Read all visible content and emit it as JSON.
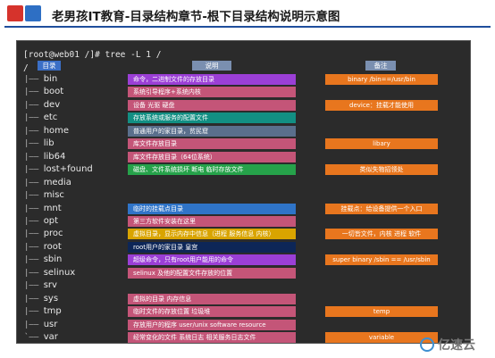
{
  "title": "老男孩IT教育-目录结构章节-根下目录结构说明示意图",
  "command": "[root@web01 /]# tree -L 1 /",
  "root_slash": "/",
  "headers": {
    "dir": "目录",
    "desc": "说明",
    "note": "备注"
  },
  "colors": {
    "orange": "#e8761e",
    "purple": "#9b3fd6",
    "pink": "#c45578",
    "teal": "#128f83",
    "slate": "#5a6f8c",
    "green": "#26a24a",
    "blue": "#2f74c8",
    "gold": "#d9a400",
    "navy": "#0d2657"
  },
  "rows": [
    {
      "tree": "|—— ",
      "name": "bin",
      "desc": "命令，二进制文件的存放目录",
      "desc_color": "purple",
      "note": "binary /bin==/usr/bin"
    },
    {
      "tree": "|—— ",
      "name": "boot",
      "desc": "系统引导程序+系统内核",
      "desc_color": "pink",
      "note": ""
    },
    {
      "tree": "|—— ",
      "name": "dev",
      "desc": "设备 光驱 硬盘",
      "desc_color": "pink",
      "note": "device：挂载才能使用"
    },
    {
      "tree": "|—— ",
      "name": "etc",
      "desc": "存放系统或服务的配置文件",
      "desc_color": "teal",
      "note": ""
    },
    {
      "tree": "|—— ",
      "name": "home",
      "desc": "普通用户的家目录，贫民窟",
      "desc_color": "slate",
      "note": ""
    },
    {
      "tree": "|—— ",
      "name": "lib",
      "desc": "库文件存放目录",
      "desc_color": "pink",
      "note": "libary"
    },
    {
      "tree": "|—— ",
      "name": "lib64",
      "desc": "库文件存放目录（64位系统）",
      "desc_color": "pink",
      "note": ""
    },
    {
      "tree": "|—— ",
      "name": "lost+found",
      "desc": "磁盘、文件系统损坏 断电 临时存放文件",
      "desc_color": "green",
      "note": "类似失物招领处"
    },
    {
      "tree": "|—— ",
      "name": "media",
      "desc": "",
      "desc_color": "",
      "note": ""
    },
    {
      "tree": "|—— ",
      "name": "misc",
      "desc": "",
      "desc_color": "",
      "note": ""
    },
    {
      "tree": "|—— ",
      "name": "mnt",
      "desc": "临时的挂载点目录",
      "desc_color": "blue",
      "note": "挂载点：给设备提供一个入口"
    },
    {
      "tree": "|—— ",
      "name": "opt",
      "desc": "第三方软件安装在这里",
      "desc_color": "pink",
      "note": ""
    },
    {
      "tree": "|—— ",
      "name": "proc",
      "desc": "虚拟目录，显示内存中信息（进程 服务信息 内核）",
      "desc_color": "gold",
      "note": "一切皆文件，内核 进程 软件"
    },
    {
      "tree": "|—— ",
      "name": "root",
      "desc": "root用户的家目录 皇宫",
      "desc_color": "navy",
      "note": ""
    },
    {
      "tree": "|—— ",
      "name": "sbin",
      "desc": "超级命令，只有root用户能用的命令",
      "desc_color": "purple",
      "note": "super binary /sbin == /usr/sbin"
    },
    {
      "tree": "|—— ",
      "name": "selinux",
      "desc": "selinux 及他的配置文件存放的位置",
      "desc_color": "pink",
      "note": ""
    },
    {
      "tree": "|—— ",
      "name": "srv",
      "desc": "",
      "desc_color": "",
      "note": ""
    },
    {
      "tree": "|—— ",
      "name": "sys",
      "desc": "虚拟的目录 内存信息",
      "desc_color": "pink",
      "note": ""
    },
    {
      "tree": "|—— ",
      "name": "tmp",
      "desc": "临时文件的存放位置 垃圾堆",
      "desc_color": "pink",
      "note": "temp"
    },
    {
      "tree": "|—— ",
      "name": "usr",
      "desc": "存放用户的程序 user/unix software resource",
      "desc_color": "pink",
      "note": ""
    },
    {
      "tree": "`—— ",
      "name": "var",
      "desc": "经常变化的文件 系统日志 相关服务日志文件",
      "desc_color": "pink",
      "note": "variable"
    }
  ],
  "watermark": "亿速云"
}
